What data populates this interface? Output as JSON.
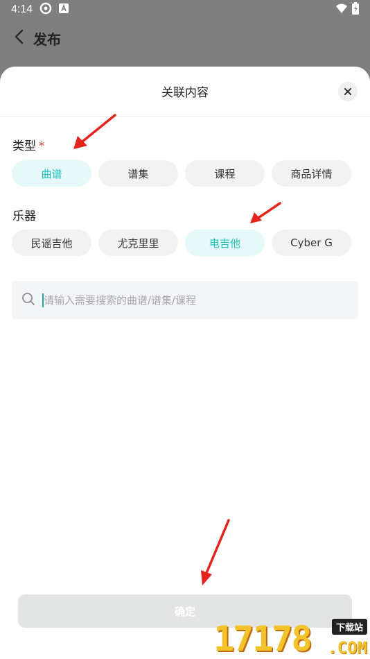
{
  "status_bar": {
    "time": "4:14"
  },
  "nav": {
    "title": "发布"
  },
  "sheet": {
    "title": "关联内容",
    "type_section": {
      "label": "类型",
      "required_mark": "*",
      "chips": [
        {
          "label": "曲谱",
          "selected": true
        },
        {
          "label": "谱集",
          "selected": false
        },
        {
          "label": "课程",
          "selected": false
        },
        {
          "label": "商品详情",
          "selected": false
        }
      ]
    },
    "instrument_section": {
      "label": "乐器",
      "chips": [
        {
          "label": "民谣吉他",
          "selected": false
        },
        {
          "label": "尤克里里",
          "selected": false
        },
        {
          "label": "电吉他",
          "selected": true
        },
        {
          "label": "Cyber G",
          "selected": false
        }
      ]
    },
    "search": {
      "value": "",
      "placeholder": "请输入需要搜索的曲谱/谱集/课程"
    },
    "confirm_label": "确定"
  },
  "watermark": {
    "digits": "17178",
    "badge": "下载站",
    "suffix": ".COM"
  },
  "colors": {
    "accent": "#1fc1bd",
    "accent_bg": "#e6f8f8",
    "required": "#e0463c",
    "arrow": "#e3231c"
  }
}
